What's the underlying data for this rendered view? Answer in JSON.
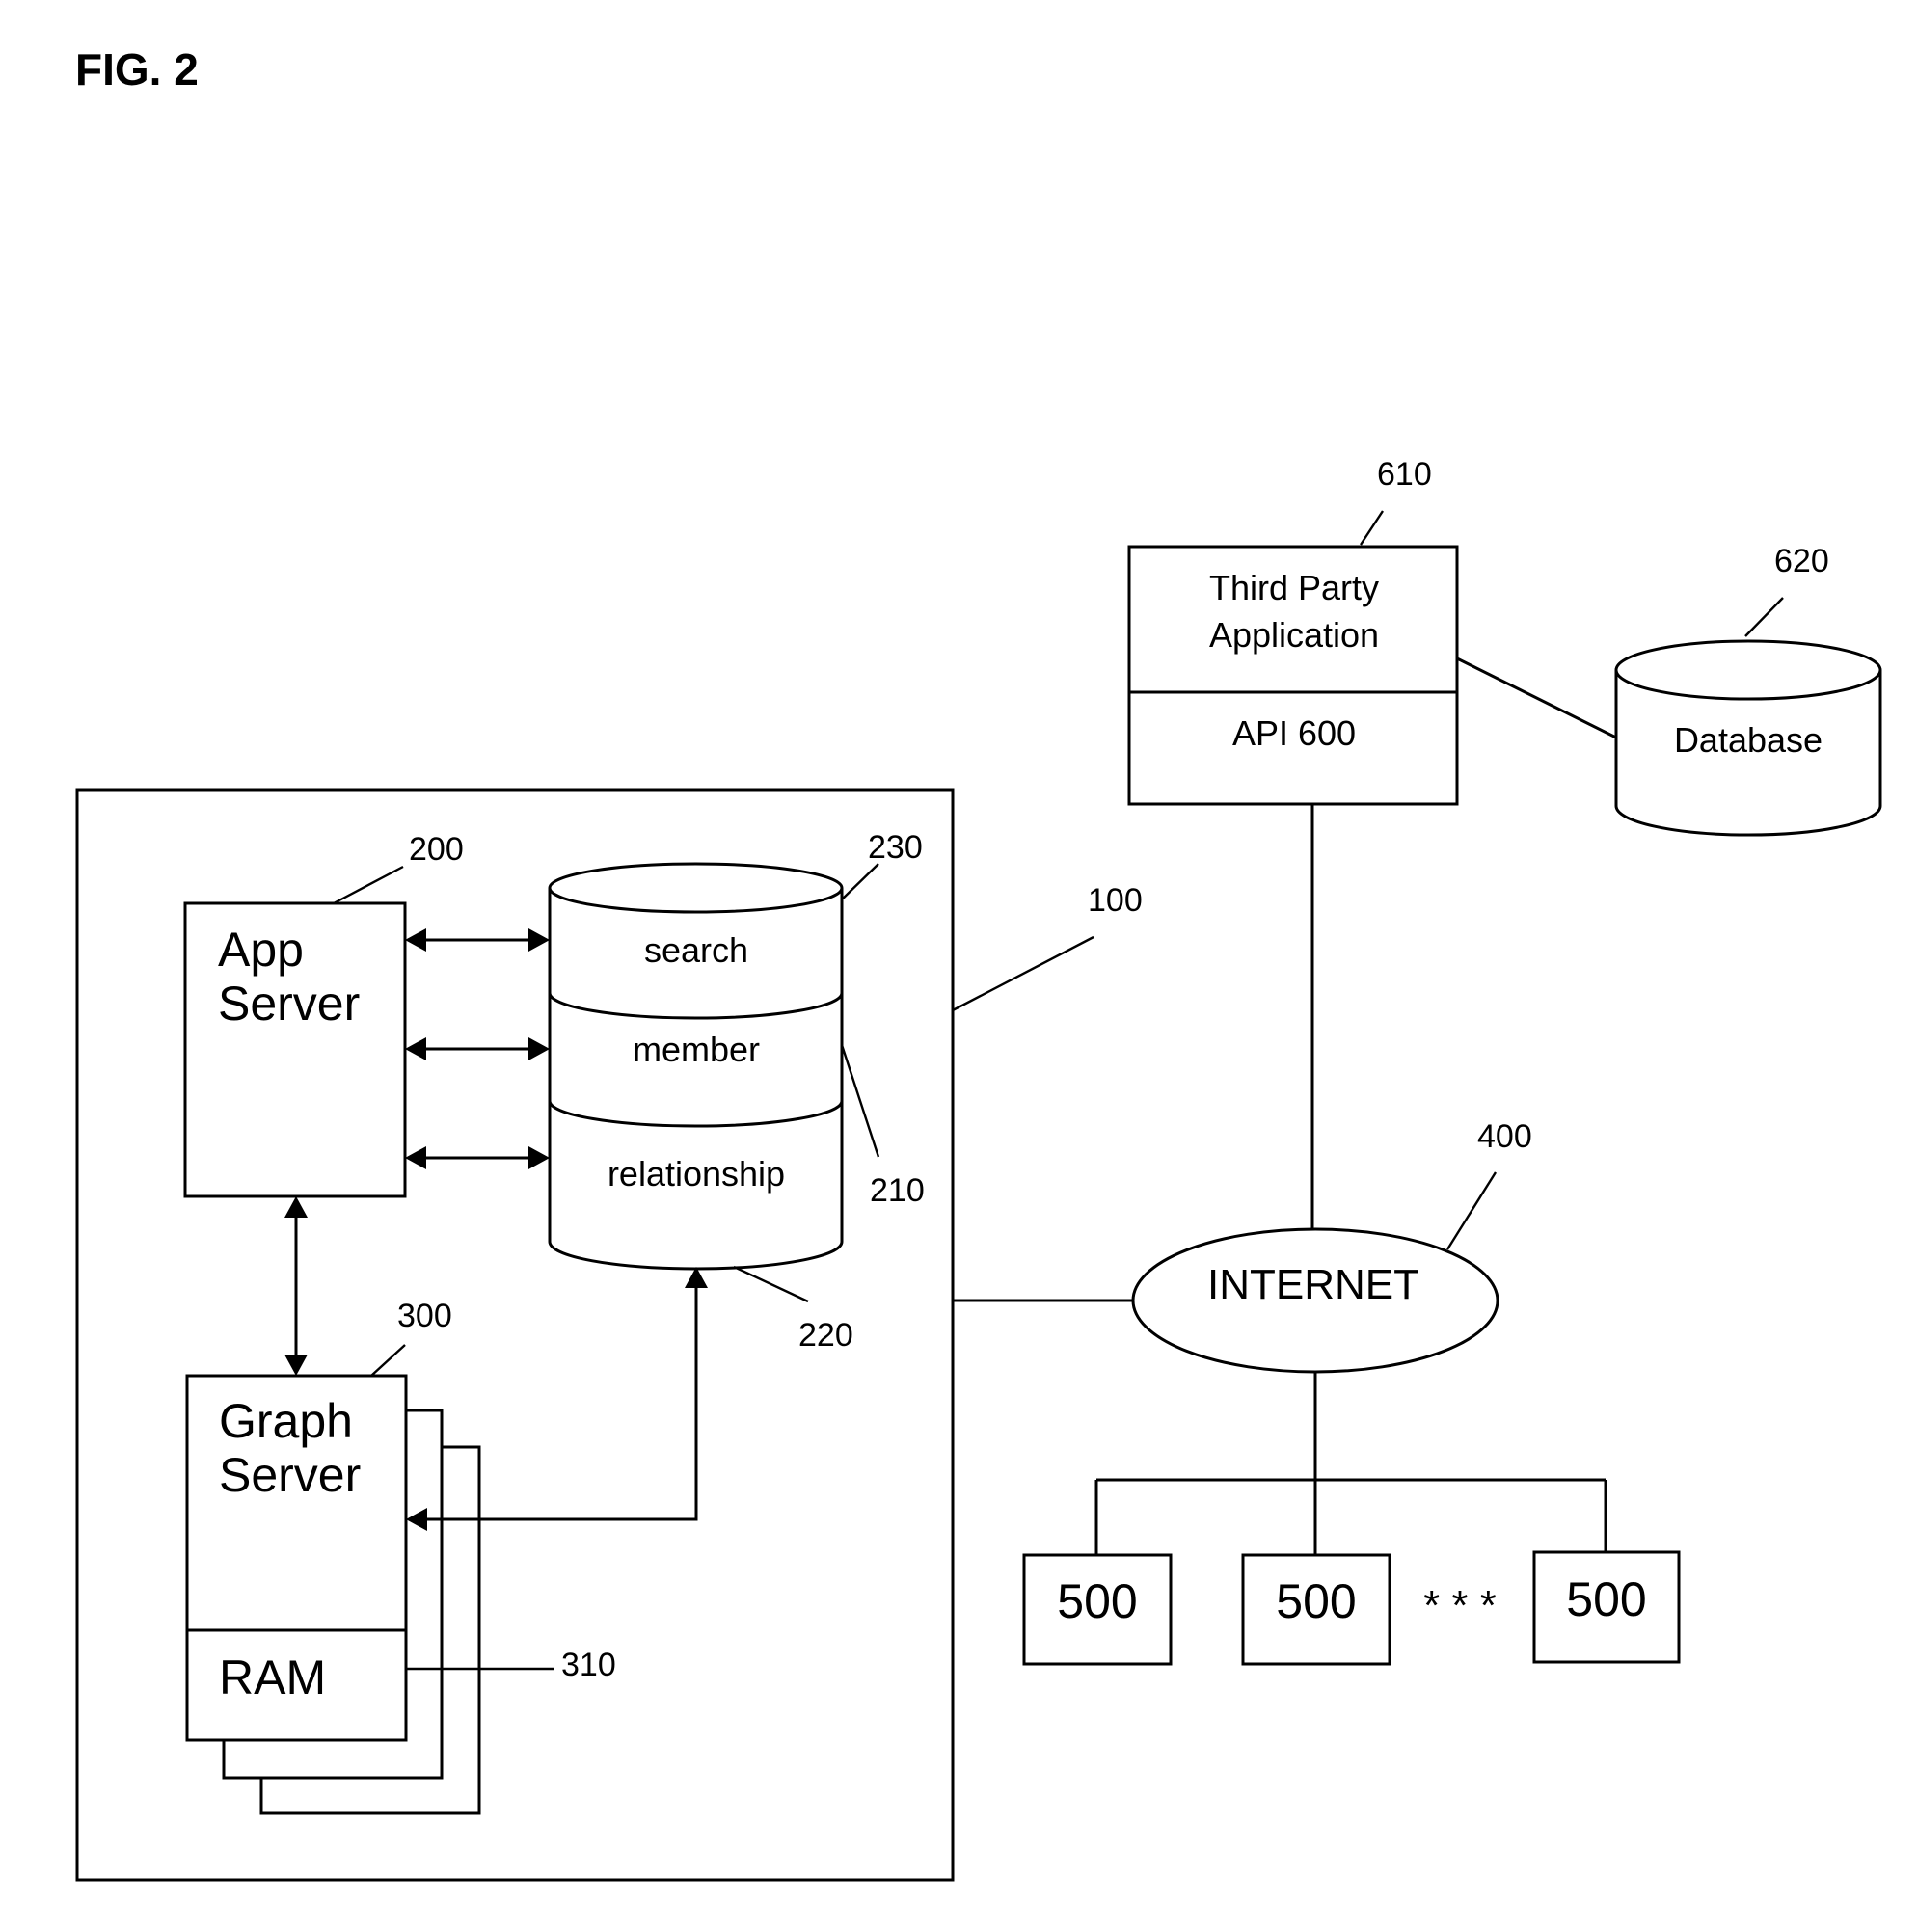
{
  "figure": {
    "title": "FIG. 2"
  },
  "system": {
    "ref": "100"
  },
  "app_server": {
    "line1": "App",
    "line2": "Server",
    "ref": "200"
  },
  "database_210": {
    "segments": [
      "search",
      "member",
      "relationship"
    ],
    "ref_cylinder": "210",
    "ref_bottom": "220",
    "ref_top": "230"
  },
  "graph_server": {
    "line1": "Graph",
    "line2": "Server",
    "ram_label": "RAM",
    "ref": "300",
    "ram_ref": "310"
  },
  "internet": {
    "label": "INTERNET",
    "ref": "400"
  },
  "clients": {
    "labels": [
      "500",
      "500",
      "500"
    ],
    "ellipsis": "* * *"
  },
  "third_party": {
    "line1": "Third Party",
    "line2": "Application",
    "api_label": "API 600",
    "ref": "610"
  },
  "external_database": {
    "label": "Database",
    "ref": "620"
  }
}
